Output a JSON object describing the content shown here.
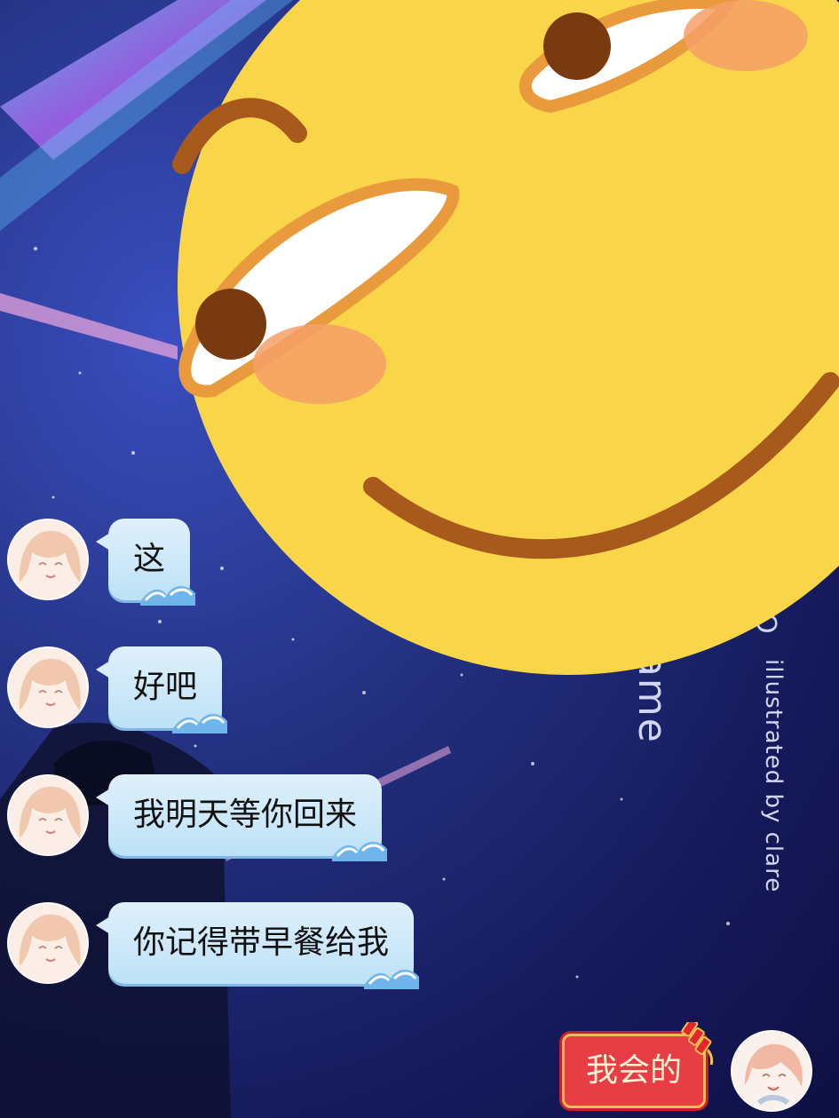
{
  "wallpaper": {
    "title": "Name",
    "credit": "illustrated by  clare",
    "mark": "O"
  },
  "chat": {
    "messages": [
      {
        "text": "这"
      },
      {
        "text": "好吧"
      },
      {
        "text": "我明天等你回来"
      },
      {
        "text": "你记得带早餐给我"
      }
    ],
    "my_message": {
      "text": "我会的"
    }
  },
  "colors": {
    "incoming_bubble": "#cfe8f9",
    "outgoing_bubble": "#e73d44",
    "emoji_face": "#f9d54a"
  }
}
